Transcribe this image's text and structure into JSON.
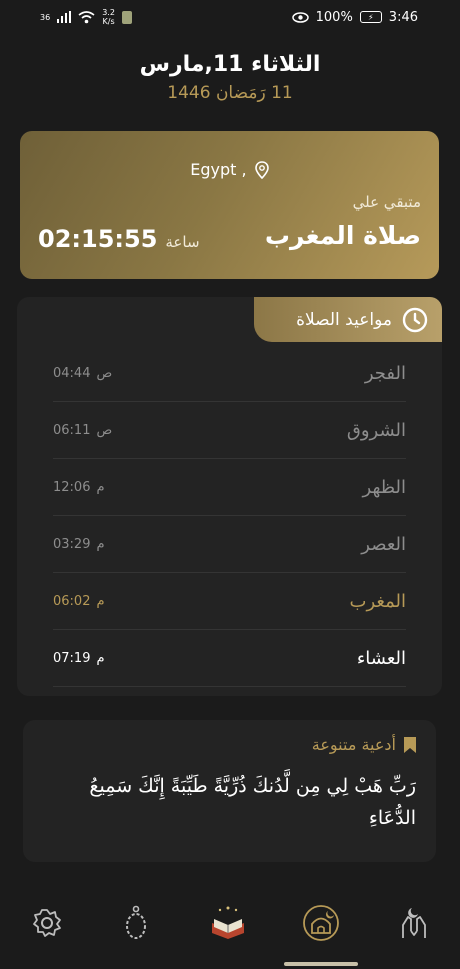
{
  "status_bar": {
    "network": "36",
    "speed_value": "3.2",
    "speed_unit": "K/s",
    "battery": "100%",
    "time": "3:46"
  },
  "header": {
    "gregorian_date": "الثلاثاء 11,مارس",
    "hijri_date": "11 رَمَضان 1446"
  },
  "next_prayer": {
    "location": "Egypt ,",
    "remaining_label": "متبقي علي",
    "prayer_name": "صلاة المغرب",
    "countdown": "02:15:55",
    "countdown_unit": "ساعة"
  },
  "prayer_times": {
    "tab_label": "مواعيد الصلاة",
    "rows": [
      {
        "name": "الفجر",
        "time": "04:44",
        "period": "ص"
      },
      {
        "name": "الشروق",
        "time": "06:11",
        "period": "ص"
      },
      {
        "name": "الظهر",
        "time": "12:06",
        "period": "م"
      },
      {
        "name": "العصر",
        "time": "03:29",
        "period": "م"
      },
      {
        "name": "المغرب",
        "time": "06:02",
        "period": "م"
      },
      {
        "name": "العشاء",
        "time": "07:19",
        "period": "م"
      }
    ]
  },
  "duas": {
    "title": "أدعية متنوعة",
    "text": "رَبِّ هَبْ لِي مِن لَّدُنكَ ذُرِّيَّةً طَيِّبَةً إِنَّكَ سَمِيعُ الدُّعَاءِ"
  },
  "colors": {
    "accent": "#b79a57",
    "background": "#1b1b1b",
    "card": "#232323"
  },
  "bottom_nav": {
    "items": [
      "settings-icon",
      "prayer-beads-icon",
      "quran-icon",
      "mosque-icon",
      "dua-hands-icon"
    ],
    "active": "mosque-icon"
  }
}
